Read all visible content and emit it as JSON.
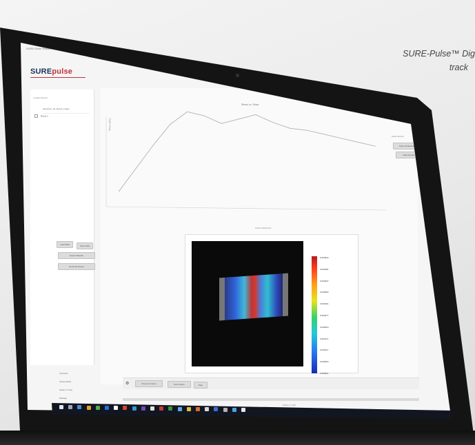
{
  "caption": {
    "line1": "SURE-Pulse™ Dig",
    "line2": "track"
  },
  "app": {
    "window_title": "SURE-Pulse Result Viewer",
    "logo": {
      "part1": "SURE",
      "part2": "pulse",
      "brand_color": "#1c2f5e",
      "accent_color": "#c0323a"
    }
  },
  "sidebar": {
    "label": "Loaded Results",
    "items": [
      "Specimen_01_Result_Image",
      "Result 1"
    ],
    "buttons": [
      "Load Data",
      "Clear Data",
      "Export Results",
      "Generate Report"
    ],
    "bottom_list": [
      "Overview",
      "Stress-Strain",
      "Strain vs Time",
      "Settings"
    ]
  },
  "chart": {
    "title": "Stress vs. Strain",
    "ylabel": "Stress (MPa)"
  },
  "right_panel": {
    "label": "Select Result",
    "buttons": [
      "Show All Results",
      "Hide Results"
    ]
  },
  "strain_view": {
    "label": "Strain Distribution",
    "sublabel": "Frame 1"
  },
  "colorbar": {
    "ticks": [
      "0.000544",
      "0.000491",
      "0.000437",
      "0.000384",
      "0.000331",
      "0.000277",
      "0.000224",
      "0.000171",
      "0.000117",
      "0.000064",
      "0.000011"
    ],
    "colors": [
      "#b51c1c",
      "#ff9d1a",
      "#e9e31a",
      "#38d16a",
      "#23c9d8",
      "#2876ef",
      "#172ab5"
    ]
  },
  "toolbar": {
    "buttons": [
      "Previous Frame",
      "Next Frame",
      "Play"
    ]
  },
  "progress": {
    "label": "Frame 1 / 120",
    "value": 0.0
  },
  "chart_data": {
    "type": "line",
    "title": "Stress vs. Strain",
    "xlabel": "",
    "ylabel": "Stress (MPa)",
    "x": [
      0,
      1,
      2,
      3,
      4,
      5,
      6,
      7,
      8,
      9,
      10,
      11,
      12,
      13,
      14,
      15
    ],
    "series": [
      {
        "values": [
          5,
          30,
          55,
          78,
          92,
          88,
          80,
          85,
          90,
          82,
          76,
          74,
          70,
          66,
          62,
          58
        ]
      }
    ],
    "grid": false
  }
}
